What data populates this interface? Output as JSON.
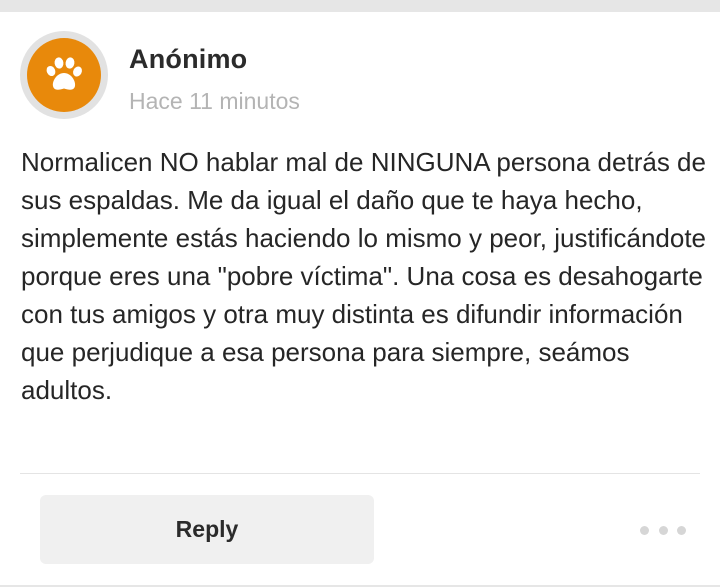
{
  "post": {
    "author": "Anónimo",
    "timestamp": "Hace 11 minutos",
    "body": "Normalicen NO hablar mal de NINGUNA persona detrás de sus espaldas. Me da igual el daño que te haya hecho, simplemente estás haciendo lo mismo y peor, justificándote porque eres una \"pobre víctima\". Una cosa es desahogarte con tus amigos y otra muy distinta es difundir información que perjudique a esa persona para siempre, seámos adultos.",
    "avatar_icon": "paw-icon",
    "avatar_color": "#e8890b"
  },
  "actions": {
    "reply_label": "Reply",
    "more_icon": "more-dots-icon"
  }
}
